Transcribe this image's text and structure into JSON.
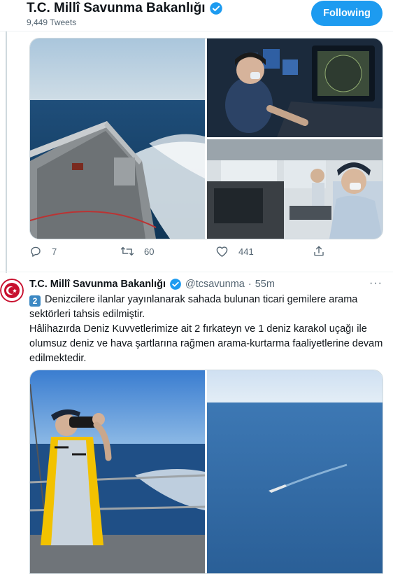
{
  "header": {
    "name": "T.C. Millî Savunma Bakanlığı",
    "tweet_count": "9,449 Tweets",
    "follow_label": "Following"
  },
  "tweet1": {
    "replies": "7",
    "retweets": "60",
    "likes": "441"
  },
  "tweet2": {
    "name": "T.C. Millî Savunma Bakanlığı",
    "handle": "@tcsavunma",
    "separator": "·",
    "time": "55m",
    "more": "···",
    "keycap": "2",
    "line1": "Denizcilere ilanlar yayınlanarak sahada bulunan ticari gemilere arama sektörleri tahsis edilmiştir.",
    "line2": "Hâlihazırda Deniz Kuvvetlerimize ait 2 fırkateyn ve 1 deniz karakol uçağı ile olumsuz deniz ve hava şartlarına rağmen arama-kurtarma faaliyetlerine devam edilmektedir."
  },
  "colors": {
    "accent": "#1d9bf0",
    "verified": "#1d9bf0",
    "muted": "#536471",
    "avatar_red": "#c8102e"
  },
  "icons": [
    "verified-badge-icon",
    "reply-icon",
    "retweet-icon",
    "like-icon",
    "share-icon",
    "more-icon",
    "ministry-seal-icon"
  ]
}
